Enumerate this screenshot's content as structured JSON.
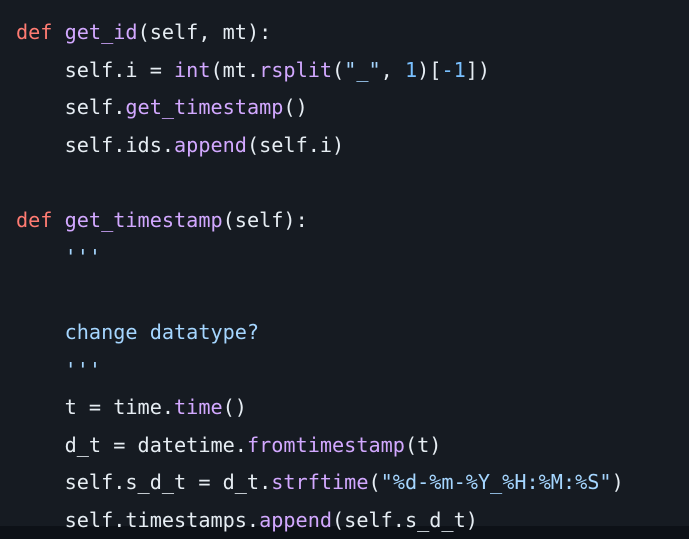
{
  "code": {
    "language": "python",
    "lines": [
      [
        {
          "t": "def",
          "c": "kw"
        },
        {
          "t": " ",
          "c": "pl"
        },
        {
          "t": "get_id",
          "c": "fn"
        },
        {
          "t": "(self, mt):",
          "c": "pl"
        }
      ],
      [
        {
          "t": "    ",
          "c": "pl"
        },
        {
          "t": "self.i = ",
          "c": "pl"
        },
        {
          "t": "int",
          "c": "fn"
        },
        {
          "t": "(mt.",
          "c": "pl"
        },
        {
          "t": "rsplit",
          "c": "fn"
        },
        {
          "t": "(",
          "c": "pl"
        },
        {
          "t": "\"_\"",
          "c": "str"
        },
        {
          "t": ", ",
          "c": "pl"
        },
        {
          "t": "1",
          "c": "num"
        },
        {
          "t": ")[",
          "c": "pl"
        },
        {
          "t": "-1",
          "c": "num"
        },
        {
          "t": "])",
          "c": "pl"
        }
      ],
      [
        {
          "t": "    ",
          "c": "pl"
        },
        {
          "t": "self.",
          "c": "pl"
        },
        {
          "t": "get_timestamp",
          "c": "fn"
        },
        {
          "t": "()",
          "c": "pl"
        }
      ],
      [
        {
          "t": "    ",
          "c": "pl"
        },
        {
          "t": "self.ids.",
          "c": "pl"
        },
        {
          "t": "append",
          "c": "fn"
        },
        {
          "t": "(self.i)",
          "c": "pl"
        }
      ],
      [],
      [
        {
          "t": "def",
          "c": "kw"
        },
        {
          "t": " ",
          "c": "pl"
        },
        {
          "t": "get_timestamp",
          "c": "fn"
        },
        {
          "t": "(self):",
          "c": "pl"
        }
      ],
      [
        {
          "t": "    ",
          "c": "pl"
        },
        {
          "t": "'''",
          "c": "doc"
        }
      ],
      [],
      [
        {
          "t": "    ",
          "c": "pl"
        },
        {
          "t": "change datatype?",
          "c": "doc"
        }
      ],
      [
        {
          "t": "    ",
          "c": "pl"
        },
        {
          "t": "'''",
          "c": "doc"
        }
      ],
      [
        {
          "t": "    ",
          "c": "pl"
        },
        {
          "t": "t = time.",
          "c": "pl"
        },
        {
          "t": "time",
          "c": "fn"
        },
        {
          "t": "()",
          "c": "pl"
        }
      ],
      [
        {
          "t": "    ",
          "c": "pl"
        },
        {
          "t": "d_t = datetime.",
          "c": "pl"
        },
        {
          "t": "fromtimestamp",
          "c": "fn"
        },
        {
          "t": "(t)",
          "c": "pl"
        }
      ],
      [
        {
          "t": "    ",
          "c": "pl"
        },
        {
          "t": "self.s_d_t = d_t.",
          "c": "pl"
        },
        {
          "t": "strftime",
          "c": "fn"
        },
        {
          "t": "(",
          "c": "pl"
        },
        {
          "t": "\"%d-%m-%Y_%H:%M:%S\"",
          "c": "str"
        },
        {
          "t": ")",
          "c": "pl"
        }
      ],
      [
        {
          "t": "    ",
          "c": "pl"
        },
        {
          "t": "self.timestamps.",
          "c": "pl"
        },
        {
          "t": "append",
          "c": "fn"
        },
        {
          "t": "(self.s_d_t)",
          "c": "pl"
        }
      ]
    ]
  }
}
